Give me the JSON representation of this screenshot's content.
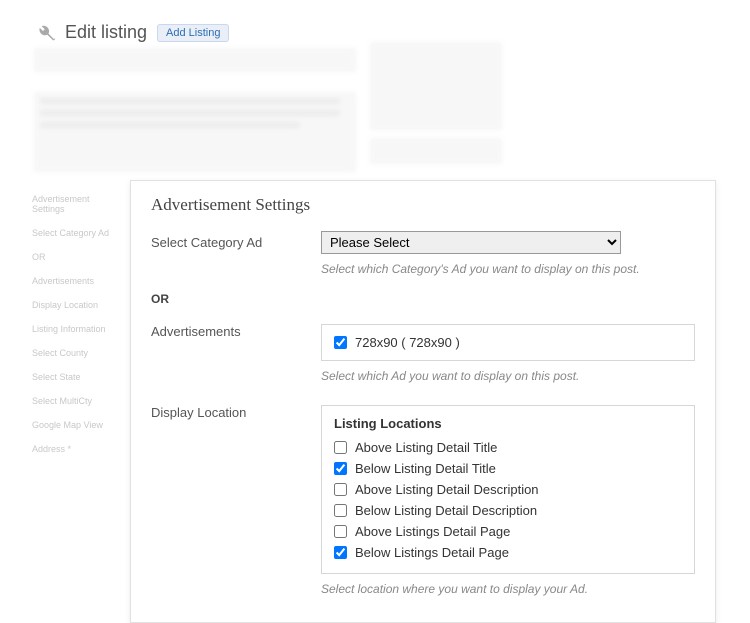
{
  "page": {
    "title": "Edit listing",
    "add_btn": "Add Listing"
  },
  "sidebar_hint": {
    "items": [
      "Advertisement Settings",
      "Select Category Ad",
      "OR",
      "Advertisements",
      "Display Location",
      "Listing Information",
      "Select County",
      "Select State",
      "Select MultiCty",
      "Google Map View",
      "Address *"
    ]
  },
  "panel": {
    "title": "Advertisement Settings",
    "category": {
      "label": "Select Category Ad",
      "placeholder": "Please Select",
      "hint": "Select which Category's Ad you want to display on this post."
    },
    "or_label": "OR",
    "ads": {
      "label": "Advertisements",
      "option": {
        "label": "728x90   ( 728x90 )",
        "checked": true
      },
      "hint": "Select which Ad you want to display on this post."
    },
    "display": {
      "label": "Display Location",
      "box_title": "Listing Locations",
      "options": [
        {
          "label": "Above Listing Detail Title",
          "checked": false
        },
        {
          "label": "Below Listing Detail Title",
          "checked": true
        },
        {
          "label": "Above Listing Detail Description",
          "checked": false
        },
        {
          "label": "Below Listing Detail Description",
          "checked": false
        },
        {
          "label": "Above Listings Detail Page",
          "checked": false
        },
        {
          "label": "Below Listings Detail Page",
          "checked": true
        }
      ],
      "hint": "Select location where you want to display your Ad."
    }
  }
}
